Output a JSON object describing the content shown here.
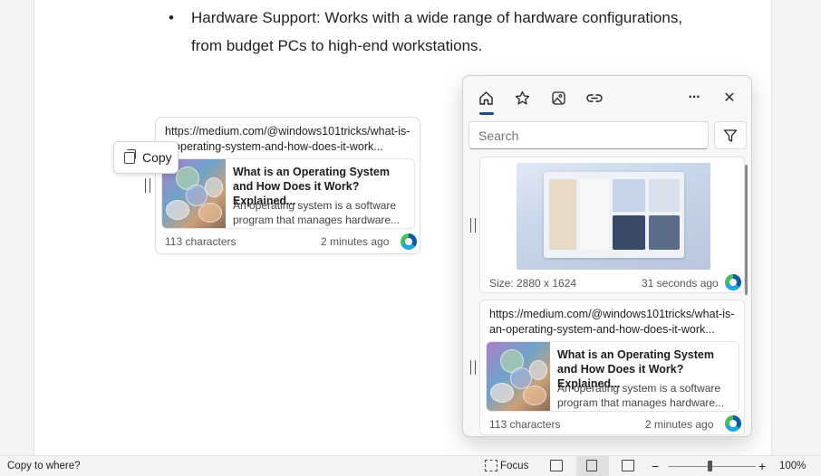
{
  "document": {
    "bullet_marker": "•",
    "bullet_text": "Hardware Support: Works with a wide range of hardware configurations, from budget PCs to high-end workstations."
  },
  "drag_card": {
    "url_line1": "https://medium.com/@windows101tricks/what-is-",
    "url_line2": "an-operating-system-and-how-does-it-work...",
    "title": "What is an Operating System and How Does it Work? Explained...",
    "description": "An operating system is a software program that manages hardware...",
    "chars": "113 characters",
    "time": "2 minutes ago",
    "browser_icon": "edge-icon"
  },
  "copy_tooltip": {
    "label": "Copy",
    "icon": "copy-icon"
  },
  "clipboard_panel": {
    "tabs": [
      {
        "name": "home",
        "icon": "home-icon"
      },
      {
        "name": "favorites",
        "icon": "star-icon"
      },
      {
        "name": "images",
        "icon": "image-icon"
      },
      {
        "name": "links",
        "icon": "link-icon"
      }
    ],
    "more_label": "···",
    "close_label": "✕",
    "search_placeholder": "Search",
    "items": [
      {
        "type": "image",
        "size": "Size: 2880 x 1624",
        "time": "31 seconds ago"
      },
      {
        "type": "link",
        "url_line1": "https://medium.com/@windows101tricks/what-is-",
        "url_line2": "an-operating-system-and-how-does-it-work...",
        "title": "What is an Operating System and How Does it Work? Explained...",
        "description": "An operating system is a software program that manages hardware...",
        "chars": "113 characters",
        "time": "2 minutes ago"
      }
    ]
  },
  "status_bar": {
    "left_text": "Copy to where?",
    "focus_label": "Focus",
    "zoom_minus": "−",
    "zoom_plus": "+",
    "zoom": "100%"
  }
}
